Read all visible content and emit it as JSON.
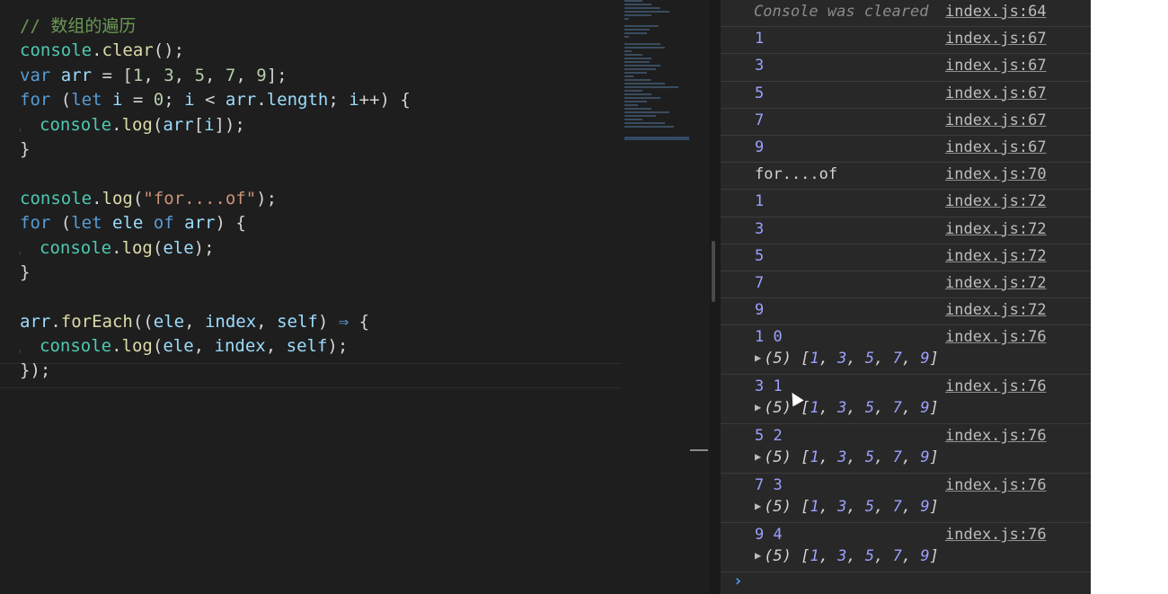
{
  "editor": {
    "lines": [
      [
        {
          "t": "// 数组的遍历",
          "c": "c-comment"
        }
      ],
      [
        {
          "t": "console",
          "c": "c-obj"
        },
        {
          "t": ".",
          "c": "c-punc"
        },
        {
          "t": "clear",
          "c": "c-fn"
        },
        {
          "t": "();",
          "c": "c-punc"
        }
      ],
      [
        {
          "t": "var",
          "c": "c-kw"
        },
        {
          "t": " ",
          "c": "c-punc"
        },
        {
          "t": "arr",
          "c": "c-var"
        },
        {
          "t": " = [",
          "c": "c-punc"
        },
        {
          "t": "1",
          "c": "c-num"
        },
        {
          "t": ", ",
          "c": "c-punc"
        },
        {
          "t": "3",
          "c": "c-num"
        },
        {
          "t": ", ",
          "c": "c-punc"
        },
        {
          "t": "5",
          "c": "c-num"
        },
        {
          "t": ", ",
          "c": "c-punc"
        },
        {
          "t": "7",
          "c": "c-num"
        },
        {
          "t": ", ",
          "c": "c-punc"
        },
        {
          "t": "9",
          "c": "c-num"
        },
        {
          "t": "];",
          "c": "c-punc"
        }
      ],
      [
        {
          "t": "for",
          "c": "c-ctrl"
        },
        {
          "t": " (",
          "c": "c-punc"
        },
        {
          "t": "let",
          "c": "c-kw"
        },
        {
          "t": " ",
          "c": "c-punc"
        },
        {
          "t": "i",
          "c": "c-var"
        },
        {
          "t": " = ",
          "c": "c-punc"
        },
        {
          "t": "0",
          "c": "c-num"
        },
        {
          "t": "; ",
          "c": "c-punc"
        },
        {
          "t": "i",
          "c": "c-var"
        },
        {
          "t": " < ",
          "c": "c-punc"
        },
        {
          "t": "arr",
          "c": "c-var"
        },
        {
          "t": ".",
          "c": "c-punc"
        },
        {
          "t": "length",
          "c": "c-var"
        },
        {
          "t": "; ",
          "c": "c-punc"
        },
        {
          "t": "i",
          "c": "c-var"
        },
        {
          "t": "++) {",
          "c": "c-punc"
        }
      ],
      [
        {
          "indent": 1
        },
        {
          "t": "console",
          "c": "c-obj"
        },
        {
          "t": ".",
          "c": "c-punc"
        },
        {
          "t": "log",
          "c": "c-fn"
        },
        {
          "t": "(",
          "c": "c-punc"
        },
        {
          "t": "arr",
          "c": "c-var"
        },
        {
          "t": "[",
          "c": "c-punc"
        },
        {
          "t": "i",
          "c": "c-var"
        },
        {
          "t": "]);",
          "c": "c-punc"
        }
      ],
      [
        {
          "t": "}",
          "c": "c-punc"
        }
      ],
      [],
      [
        {
          "t": "console",
          "c": "c-obj"
        },
        {
          "t": ".",
          "c": "c-punc"
        },
        {
          "t": "log",
          "c": "c-fn"
        },
        {
          "t": "(",
          "c": "c-punc"
        },
        {
          "t": "\"for....of\"",
          "c": "c-str"
        },
        {
          "t": ");",
          "c": "c-punc"
        }
      ],
      [
        {
          "t": "for",
          "c": "c-ctrl"
        },
        {
          "t": " (",
          "c": "c-punc"
        },
        {
          "t": "let",
          "c": "c-kw"
        },
        {
          "t": " ",
          "c": "c-punc"
        },
        {
          "t": "ele",
          "c": "c-var"
        },
        {
          "t": " ",
          "c": "c-punc"
        },
        {
          "t": "of",
          "c": "c-kw"
        },
        {
          "t": " ",
          "c": "c-punc"
        },
        {
          "t": "arr",
          "c": "c-var"
        },
        {
          "t": ") {",
          "c": "c-punc"
        }
      ],
      [
        {
          "indent": 1
        },
        {
          "t": "console",
          "c": "c-obj"
        },
        {
          "t": ".",
          "c": "c-punc"
        },
        {
          "t": "log",
          "c": "c-fn"
        },
        {
          "t": "(",
          "c": "c-punc"
        },
        {
          "t": "ele",
          "c": "c-var"
        },
        {
          "t": ");",
          "c": "c-punc"
        }
      ],
      [
        {
          "t": "}",
          "c": "c-punc"
        }
      ],
      [],
      [
        {
          "t": "arr",
          "c": "c-var"
        },
        {
          "t": ".",
          "c": "c-punc"
        },
        {
          "t": "forEach",
          "c": "c-fn"
        },
        {
          "t": "((",
          "c": "c-punc"
        },
        {
          "t": "ele",
          "c": "c-var"
        },
        {
          "t": ", ",
          "c": "c-punc"
        },
        {
          "t": "index",
          "c": "c-var"
        },
        {
          "t": ", ",
          "c": "c-punc"
        },
        {
          "t": "self",
          "c": "c-var"
        },
        {
          "t": ") ",
          "c": "c-punc"
        },
        {
          "t": "⇒",
          "c": "c-kw"
        },
        {
          "t": " {",
          "c": "c-punc"
        }
      ],
      [
        {
          "indent": 1
        },
        {
          "t": "console",
          "c": "c-obj"
        },
        {
          "t": ".",
          "c": "c-punc"
        },
        {
          "t": "log",
          "c": "c-fn"
        },
        {
          "t": "(",
          "c": "c-punc"
        },
        {
          "t": "ele",
          "c": "c-var"
        },
        {
          "t": ", ",
          "c": "c-punc"
        },
        {
          "t": "index",
          "c": "c-var"
        },
        {
          "t": ", ",
          "c": "c-punc"
        },
        {
          "t": "self",
          "c": "c-var"
        },
        {
          "t": ");",
          "c": "c-punc"
        }
      ],
      [
        {
          "t": "});",
          "c": "c-punc"
        }
      ]
    ]
  },
  "console": {
    "entries": [
      {
        "msg": "Console was cleared",
        "style": "cleared",
        "src": "index.js:64"
      },
      {
        "msg": "1",
        "src": "index.js:67"
      },
      {
        "msg": "3",
        "src": "index.js:67"
      },
      {
        "msg": "5",
        "src": "index.js:67"
      },
      {
        "msg": "7",
        "src": "index.js:67"
      },
      {
        "msg": "9",
        "src": "index.js:67"
      },
      {
        "msg": "for....of",
        "style": "plain",
        "src": "index.js:70"
      },
      {
        "msg": "1",
        "src": "index.js:72"
      },
      {
        "msg": "3",
        "src": "index.js:72"
      },
      {
        "msg": "5",
        "src": "index.js:72"
      },
      {
        "msg": "7",
        "src": "index.js:72"
      },
      {
        "msg": "9",
        "src": "index.js:72"
      },
      {
        "msg": "1 0",
        "src": "index.js:76",
        "array": {
          "length": "(5)",
          "items": [
            "1",
            "3",
            "5",
            "7",
            "9"
          ]
        }
      },
      {
        "msg": "3 1",
        "src": "index.js:76",
        "array": {
          "length": "(5)",
          "items": [
            "1",
            "3",
            "5",
            "7",
            "9"
          ]
        }
      },
      {
        "msg": "5 2",
        "src": "index.js:76",
        "array": {
          "length": "(5)",
          "items": [
            "1",
            "3",
            "5",
            "7",
            "9"
          ]
        }
      },
      {
        "msg": "7 3",
        "src": "index.js:76",
        "array": {
          "length": "(5)",
          "items": [
            "1",
            "3",
            "5",
            "7",
            "9"
          ]
        }
      },
      {
        "msg": "9 4",
        "src": "index.js:76",
        "array": {
          "length": "(5)",
          "items": [
            "1",
            "3",
            "5",
            "7",
            "9"
          ]
        }
      }
    ],
    "prompt_icon": "chevron-right-icon"
  }
}
